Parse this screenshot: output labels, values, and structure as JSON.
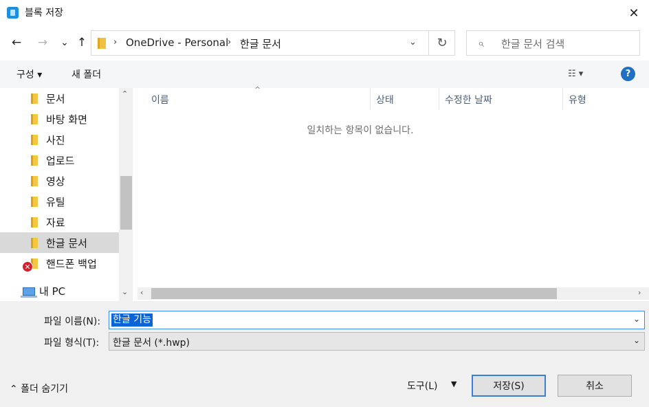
{
  "window": {
    "title": "블록 저장",
    "close_glyph": "✕",
    "app_icon": "hwp-app-icon"
  },
  "nav": {
    "back": "←",
    "forward": "→",
    "history": "⌄",
    "up": "↑"
  },
  "address": {
    "crumbs": [
      "OneDrive - Personal",
      "한글 문서"
    ],
    "separator": "›",
    "dropdown": "⌄",
    "refresh": "↻"
  },
  "search": {
    "placeholder": "한글 문서 검색",
    "icon": "⌕"
  },
  "toolbar": {
    "organize": "구성 ▾",
    "new_folder": "새 폴더",
    "view_icon": "☷  ▾",
    "help": "?"
  },
  "sidebar": {
    "items": [
      {
        "label": "문서"
      },
      {
        "label": "바탕 화면"
      },
      {
        "label": "사진"
      },
      {
        "label": "업로드"
      },
      {
        "label": "영상"
      },
      {
        "label": "유틸"
      },
      {
        "label": "자료"
      },
      {
        "label": "한글 문서",
        "selected": true
      },
      {
        "label": "핸드폰 백업",
        "error": true
      }
    ],
    "pc_label": "내 PC",
    "error_glyph": "✕"
  },
  "columns": [
    "이름",
    "상태",
    "수정한 날짜",
    "유형"
  ],
  "list": {
    "empty_message": "일치하는 항목이 없습니다.",
    "sort_caret": "^"
  },
  "scroll": {
    "up": "⌃",
    "down": "⌄",
    "left": "‹",
    "right": "›"
  },
  "form": {
    "filename_label": "파일 이름(N):",
    "filename_value": "한글 기능",
    "filetype_label": "파일 형식(T):",
    "filetype_value": "한글 문서 (*.hwp)",
    "combo_arrow": "⌄"
  },
  "footer": {
    "hide_folders": "⌃  폴더 숨기기",
    "tools": "도구(L)",
    "tools_caret": "▼",
    "save": "저장(S)",
    "cancel": "취소"
  }
}
